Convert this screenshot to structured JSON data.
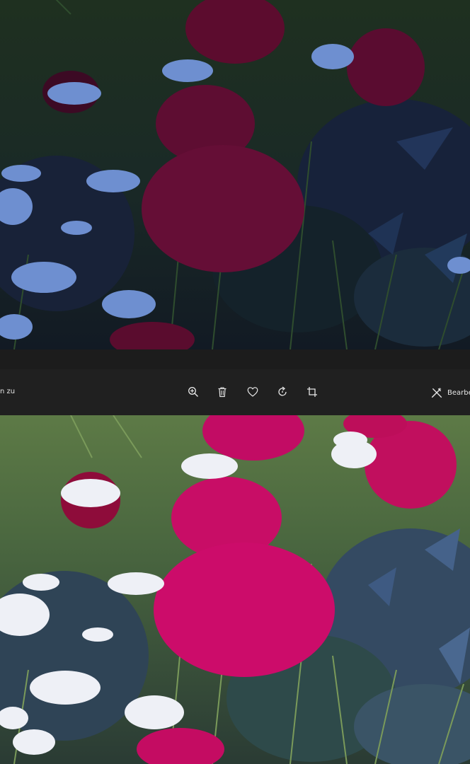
{
  "toolbar": {
    "left_text": "n zu",
    "edit_label": "Bearbe",
    "buttons": [
      "zoom-in-icon",
      "delete-icon",
      "favorite-icon",
      "rotate-icon",
      "crop-icon",
      "edit-icon"
    ]
  },
  "colors": {
    "chrome_dark": "#202020",
    "strip": "#1c1c1c",
    "text": "#e6e6e6",
    "peony_dark": "#7a0f3f",
    "peony_bright": "#c20c64",
    "grass_dark": "#1d2e1f",
    "grass_bright": "#5a7b45"
  }
}
